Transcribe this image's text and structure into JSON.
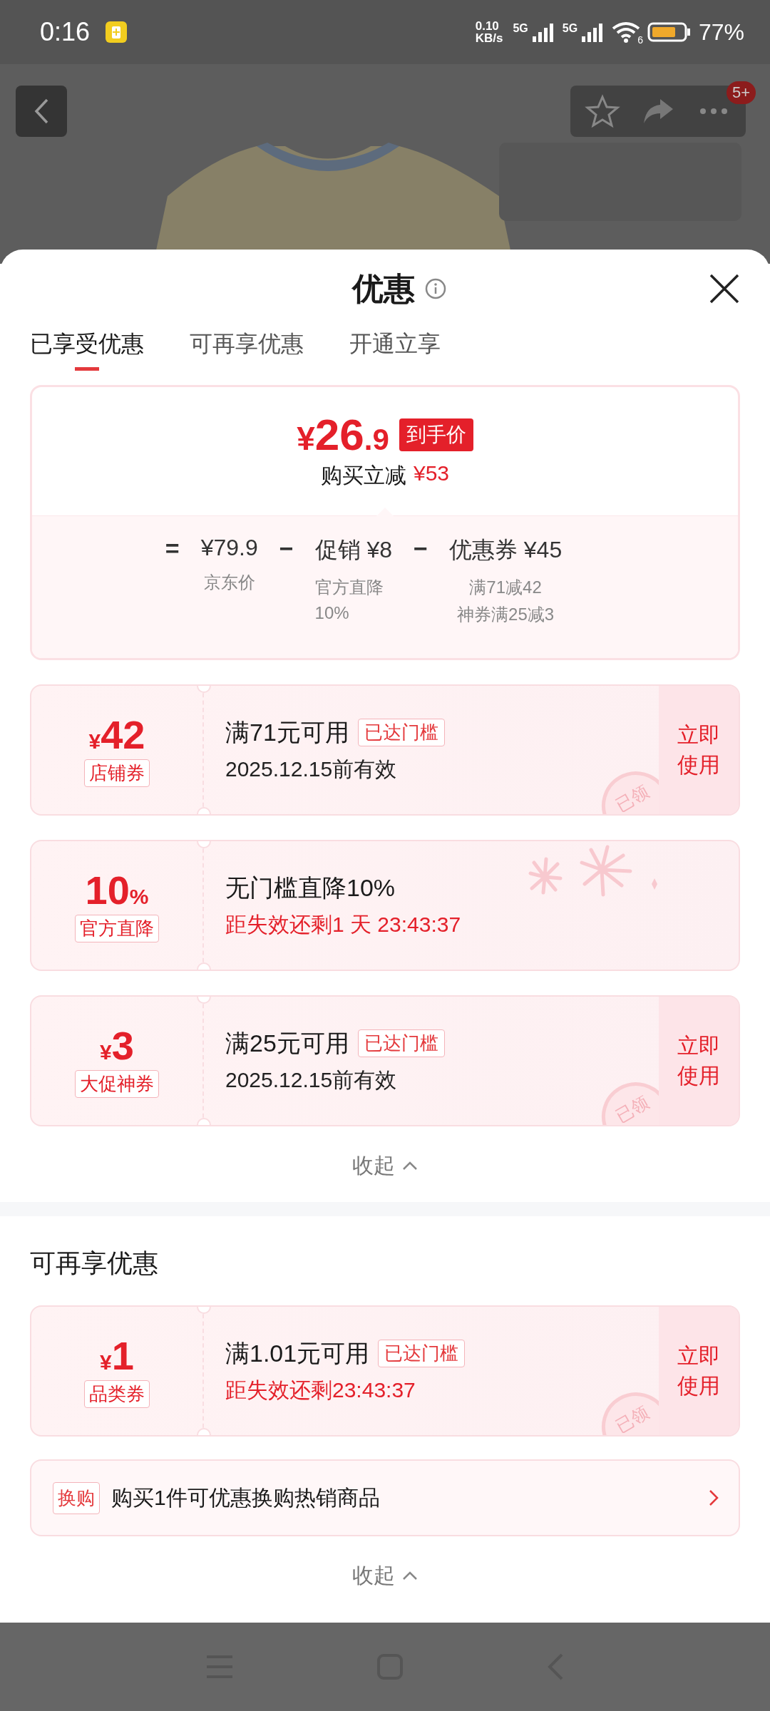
{
  "status_bar": {
    "time": "0:16",
    "net_speed_value": "0.10",
    "net_speed_unit": "KB/s",
    "signals": [
      "5G",
      "5G"
    ],
    "wifi_badge": "6",
    "battery": "77%"
  },
  "header": {
    "more_badge": "5+"
  },
  "sheet": {
    "title": "优惠",
    "tabs": [
      {
        "label": "已享受优惠",
        "selected": true
      },
      {
        "label": "可再享优惠",
        "selected": false
      },
      {
        "label": "开通立享",
        "selected": false
      }
    ]
  },
  "summary": {
    "currency": "¥",
    "price_int": "26",
    "price_dec": ".9",
    "price_tag": "到手价",
    "saving_label": "购买立减",
    "saving": "¥53",
    "breakdown": [
      {
        "op": "=",
        "value": "¥79.9",
        "notes": [
          "京东价"
        ]
      },
      {
        "op": "−",
        "value": "促销 ¥8",
        "notes": [
          "官方直降",
          "10%"
        ]
      },
      {
        "op": "−",
        "value": "优惠券 ¥45",
        "notes": [
          "满71减42",
          "神券满25减3"
        ]
      }
    ]
  },
  "sections": [
    {
      "coupons": [
        {
          "prefix": "¥",
          "amount": "42",
          "type_label": "店铺券",
          "condition": "满71元可用",
          "badge": "已达门槛",
          "validity": "2025.12.15前有效",
          "urgent": false,
          "action": "立即使用",
          "stamp": "已领",
          "fireworks": false
        },
        {
          "amount": "10",
          "suffix": "%",
          "type_label": "官方直降",
          "condition": "无门槛直降10%",
          "validity": "距失效还剩1 天 23:43:37",
          "urgent": true,
          "fireworks": true
        },
        {
          "prefix": "¥",
          "amount": "3",
          "type_label": "大促神券",
          "condition": "满25元可用",
          "badge": "已达门槛",
          "validity": "2025.12.15前有效",
          "urgent": false,
          "action": "立即使用",
          "stamp": "已领",
          "fireworks": false
        }
      ],
      "collapse": "收起"
    },
    {
      "title": "可再享优惠",
      "coupons": [
        {
          "prefix": "¥",
          "amount": "1",
          "type_label": "品类券",
          "condition": "满1.01元可用",
          "badge": "已达门槛",
          "validity": "距失效还剩23:43:37",
          "urgent": true,
          "action": "立即使用",
          "stamp": "已领",
          "fireworks": false
        }
      ],
      "swap": {
        "tag": "换购",
        "text": "购买1件可优惠换购热销商品"
      },
      "collapse": "收起"
    }
  ]
}
